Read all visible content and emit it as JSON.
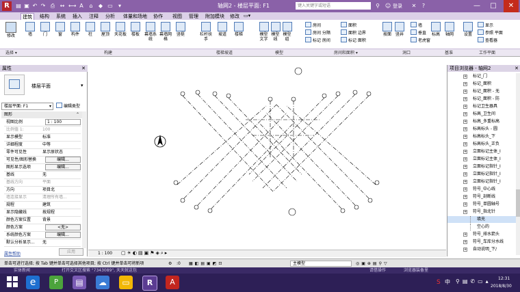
{
  "titlebar": {
    "app_logo": "R",
    "window_title": "轴网2 - 楼层平面: F1",
    "search_placeholder": "键入关键字或短语",
    "login": "登录",
    "help": "?",
    "minimize": "—",
    "maximize": "□",
    "close": "✕"
  },
  "tabs": [
    "建筑",
    "结构",
    "系统",
    "插入",
    "注释",
    "分析",
    "体量和场地",
    "协作",
    "视图",
    "管理",
    "附加模块",
    "修改"
  ],
  "active_tab": "建筑",
  "ribbon": {
    "modify": "修改",
    "build_buttons": [
      "墙",
      "门",
      "窗",
      "构件",
      "柱",
      "屋顶",
      "天花板",
      "楼板",
      "幕墙系统",
      "幕墙网格",
      "竖梃"
    ],
    "circulation_buttons": [
      "栏杆扶手",
      "坡道",
      "楼梯"
    ],
    "model_buttons": [
      "模型文字",
      "模型线",
      "模型组"
    ],
    "room_rows": [
      "房间",
      "房间 分隔",
      "标记 房间",
      "面积",
      "面积 边界",
      "标记 面积"
    ],
    "opening_buttons": [
      "按面",
      "竖井",
      "墙",
      "垂直",
      "老虎窗"
    ],
    "datum_buttons": [
      "标高",
      "轴网"
    ],
    "workplane_rows": [
      "显示",
      "参照 平面",
      "查看器"
    ],
    "workplane_set": "设置"
  },
  "panels": [
    "选择 ▾",
    "构建",
    "楼梯坡道",
    "模型",
    "房间和面积 ▾",
    "洞口",
    "基准",
    "工作平面"
  ],
  "properties": {
    "header": "属性",
    "type_name": "楼层平面",
    "selector_value": "楼层平面: F1",
    "edit_type": "编辑类型",
    "section": "图形",
    "rows": [
      {
        "k": "视图比例",
        "v": "1 : 100",
        "kind": "input"
      },
      {
        "k": "比例值 1:",
        "v": "100",
        "kind": "grey"
      },
      {
        "k": "显示模型",
        "v": "标准",
        "kind": "text"
      },
      {
        "k": "详细程度",
        "v": "中等",
        "kind": "text"
      },
      {
        "k": "零件可见性",
        "v": "显示原状态",
        "kind": "text"
      },
      {
        "k": "可见性/图形替换",
        "v": "编辑...",
        "kind": "button"
      },
      {
        "k": "图形显示选项",
        "v": "编辑...",
        "kind": "button"
      },
      {
        "k": "基线",
        "v": "无",
        "kind": "text"
      },
      {
        "k": "基线方向",
        "v": "平面",
        "kind": "grey"
      },
      {
        "k": "方向",
        "v": "项目北",
        "kind": "text"
      },
      {
        "k": "墙连接显示",
        "v": "清理所有墙...",
        "kind": "grey"
      },
      {
        "k": "规程",
        "v": "建筑",
        "kind": "text"
      },
      {
        "k": "显示隐藏线",
        "v": "按规程",
        "kind": "text"
      },
      {
        "k": "颜色方案位置",
        "v": "背景",
        "kind": "text"
      },
      {
        "k": "颜色方案",
        "v": "<无>",
        "kind": "button"
      },
      {
        "k": "系统颜色方案",
        "v": "编辑...",
        "kind": "button"
      },
      {
        "k": "默认分析显示...",
        "v": "无",
        "kind": "text"
      }
    ],
    "help_link": "属性帮助",
    "apply": "应用"
  },
  "view_control_bar": {
    "scale": "1 : 100"
  },
  "project_browser": {
    "header": "项目浏览器 - 轴网2",
    "items": [
      {
        "label": "标记_门",
        "sel": false
      },
      {
        "label": "标记_面积",
        "sel": false
      },
      {
        "label": "标记_面积 - 无",
        "sel": false
      },
      {
        "label": "标记_面积 - 防",
        "sel": false
      },
      {
        "label": "标记卫生器具",
        "sel": false
      },
      {
        "label": "标高_卫生间",
        "sel": false
      },
      {
        "label": "标高_多重标高",
        "sel": false
      },
      {
        "label": "标高标头 - 圆",
        "sel": false
      },
      {
        "label": "标高标头_下",
        "sel": false
      },
      {
        "label": "标高标头_正负",
        "sel": false
      },
      {
        "label": "立面标记主体_I",
        "sel": false
      },
      {
        "label": "立面标记主体_I",
        "sel": false
      },
      {
        "label": "立面标记指针_I",
        "sel": false
      },
      {
        "label": "立面标记指针_I",
        "sel": false
      },
      {
        "label": "立面标记指针_I",
        "sel": false
      },
      {
        "label": "符号_中心线",
        "sel": false
      },
      {
        "label": "符号_剖断线",
        "sel": false
      },
      {
        "label": "符号_单圆轴号",
        "sel": false
      },
      {
        "label": "符号_指北针",
        "sel": false
      },
      {
        "label": "填充",
        "sel": true,
        "child": true
      },
      {
        "label": "空心的",
        "sel": false,
        "child": true
      },
      {
        "label": "符号_排水箭头",
        "sel": false
      },
      {
        "label": "符号_车库分水线",
        "sel": false
      },
      {
        "label": "自动说明_下/",
        "sel": false
      }
    ]
  },
  "status": {
    "hint": "单击可进行选择; 按 Tab 键并单击可选择其他项目; 按 Ctrl 键并单击可将新项",
    "zero": ":0",
    "model_select": "主模型"
  },
  "taskbar": {
    "notif_left": "实体新闻",
    "notif_mid": "打开交叉区搜索 \"7343089\", 天天就这包",
    "notif_right1": "请借操作",
    "notif_right2": "浏览器装备里",
    "time": "12:31",
    "date": "2018/8/30",
    "lang": "中"
  },
  "colors": {
    "accent": "#8a61a8",
    "ribbon_icon": "#4f7bb7",
    "taskbar": "#2d1f56"
  }
}
